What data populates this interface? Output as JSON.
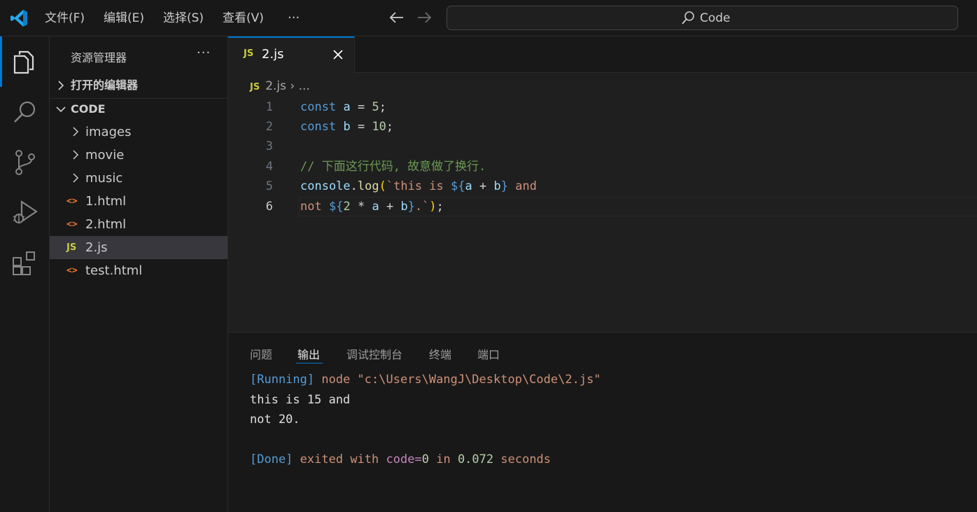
{
  "menubar": {
    "items": [
      "文件(F)",
      "编辑(E)",
      "选择(S)",
      "查看(V)"
    ],
    "more": "···"
  },
  "search": {
    "label": "Code"
  },
  "sidebar": {
    "title": "资源管理器",
    "more": "···",
    "open_editors_label": "打开的编辑器",
    "folder_label": "CODE",
    "items": [
      {
        "name": "images",
        "kind": "folder"
      },
      {
        "name": "movie",
        "kind": "folder"
      },
      {
        "name": "music",
        "kind": "folder"
      },
      {
        "name": "1.html",
        "kind": "html",
        "icon": "<>"
      },
      {
        "name": "2.html",
        "kind": "html",
        "icon": "<>"
      },
      {
        "name": "2.js",
        "kind": "js",
        "icon": "JS",
        "selected": true
      },
      {
        "name": "test.html",
        "kind": "html",
        "icon": "<>"
      }
    ]
  },
  "tab": {
    "icon": "JS",
    "label": "2.js"
  },
  "breadcrumb": {
    "icon": "JS",
    "file": "2.js",
    "sep": "›",
    "rest": "..."
  },
  "editor": {
    "line_numbers": [
      "1",
      "2",
      "3",
      "4",
      "5",
      "6"
    ],
    "active_line": "6",
    "lines": [
      "const a = 5;",
      "const b = 10;",
      "",
      "// 下面这行代码, 故意做了换行.",
      "console.log(`this is ${a + b} and",
      "not ${2 * a + b}.`);"
    ]
  },
  "panel": {
    "tabs": [
      "问题",
      "输出",
      "调试控制台",
      "终端",
      "端口"
    ],
    "active_tab": "输出",
    "output": {
      "running_tag": "[Running]",
      "running_cmd": "node \"c:\\Users\\WangJ\\Desktop\\Code\\2.js\"",
      "line1": "this is 15 and",
      "line2": "not 20.",
      "done_tag": "[Done]",
      "done_1": "exited with",
      "done_code_key": "code=",
      "done_code_val": "0",
      "done_in": "in",
      "done_time": "0.072",
      "done_seconds": "seconds"
    }
  }
}
